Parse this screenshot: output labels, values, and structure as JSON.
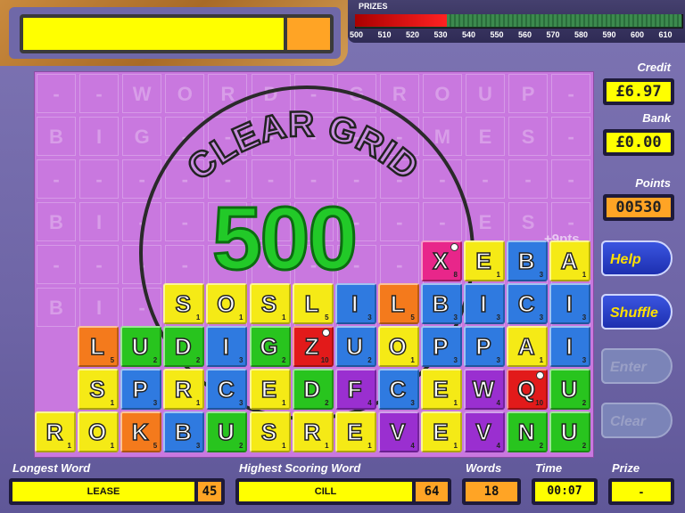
{
  "prizes": {
    "title": "PRIZES",
    "ticks": [
      "500",
      "510",
      "520",
      "530",
      "540",
      "550",
      "560",
      "570",
      "580",
      "590",
      "600",
      "610"
    ],
    "current_points": 530
  },
  "right_panel": {
    "credit_label": "Credit",
    "credit_value": "£6.97",
    "bank_label": "Bank",
    "bank_value": "£0.00",
    "points_label": "Points",
    "points_value": "00530",
    "help_label": "Help",
    "shuffle_label": "Shuffle",
    "enter_label": "Enter",
    "clear_label": "Clear"
  },
  "overlay": {
    "clear_grid_text": "CLEAR GRID",
    "bonus_value": "500",
    "pts_popup": "+9pts"
  },
  "background_letters": [
    [
      "-",
      "-",
      "W",
      "O",
      "R",
      "D",
      "-",
      "G",
      "R",
      "O",
      "U",
      "P",
      "-"
    ],
    [
      "B",
      "I",
      "G",
      "-",
      "-",
      "-",
      "-",
      "-",
      "-",
      "M",
      "E",
      "S",
      "-"
    ],
    [
      "-",
      "-",
      "-",
      "-",
      "-",
      "-",
      "-",
      "-",
      "-",
      "-",
      "-",
      "-",
      "-"
    ],
    [
      "B",
      "I",
      "-",
      "-",
      "-",
      "-",
      "-",
      "-",
      "-",
      "-",
      "E",
      "S",
      "-"
    ],
    [
      "-",
      "-",
      "-",
      "-",
      "-",
      "-",
      "-",
      "-",
      "-",
      "-",
      "-",
      "-",
      "-"
    ],
    [
      "B",
      "I",
      "-",
      "-",
      "-",
      "-",
      "-",
      "-",
      "-",
      "-",
      "-",
      "-",
      "-"
    ]
  ],
  "colors": {
    "yellow": "#f5ea16",
    "green": "#28c41e",
    "blue": "#2f7ae0",
    "orange": "#f47a1c",
    "purple": "#9a2fd0",
    "pink": "#e8268a",
    "red": "#e21a1a"
  },
  "tiles": [
    {
      "col": 9,
      "row": 4,
      "letter": "X",
      "score": "8",
      "color": "pink",
      "clock": true
    },
    {
      "col": 10,
      "row": 4,
      "letter": "E",
      "score": "1",
      "color": "yellow"
    },
    {
      "col": 11,
      "row": 4,
      "letter": "B",
      "score": "3",
      "color": "blue"
    },
    {
      "col": 12,
      "row": 4,
      "letter": "A",
      "score": "1",
      "color": "yellow"
    },
    {
      "col": 3,
      "row": 5,
      "letter": "S",
      "score": "1",
      "color": "yellow"
    },
    {
      "col": 4,
      "row": 5,
      "letter": "O",
      "score": "1",
      "color": "yellow"
    },
    {
      "col": 5,
      "row": 5,
      "letter": "S",
      "score": "1",
      "color": "yellow"
    },
    {
      "col": 6,
      "row": 5,
      "letter": "L",
      "score": "5",
      "color": "yellow"
    },
    {
      "col": 7,
      "row": 5,
      "letter": "I",
      "score": "3",
      "color": "blue"
    },
    {
      "col": 8,
      "row": 5,
      "letter": "L",
      "score": "5",
      "color": "orange"
    },
    {
      "col": 9,
      "row": 5,
      "letter": "B",
      "score": "3",
      "color": "blue"
    },
    {
      "col": 10,
      "row": 5,
      "letter": "I",
      "score": "3",
      "color": "blue"
    },
    {
      "col": 11,
      "row": 5,
      "letter": "C",
      "score": "3",
      "color": "blue"
    },
    {
      "col": 12,
      "row": 5,
      "letter": "I",
      "score": "3",
      "color": "blue"
    },
    {
      "col": 1,
      "row": 6,
      "letter": "L",
      "score": "5",
      "color": "orange"
    },
    {
      "col": 2,
      "row": 6,
      "letter": "U",
      "score": "2",
      "color": "green"
    },
    {
      "col": 3,
      "row": 6,
      "letter": "D",
      "score": "2",
      "color": "green"
    },
    {
      "col": 4,
      "row": 6,
      "letter": "I",
      "score": "3",
      "color": "blue"
    },
    {
      "col": 5,
      "row": 6,
      "letter": "G",
      "score": "2",
      "color": "green"
    },
    {
      "col": 6,
      "row": 6,
      "letter": "Z",
      "score": "10",
      "color": "red",
      "clock": true
    },
    {
      "col": 7,
      "row": 6,
      "letter": "U",
      "score": "2",
      "color": "blue"
    },
    {
      "col": 8,
      "row": 6,
      "letter": "O",
      "score": "1",
      "color": "yellow"
    },
    {
      "col": 9,
      "row": 6,
      "letter": "P",
      "score": "3",
      "color": "blue"
    },
    {
      "col": 10,
      "row": 6,
      "letter": "P",
      "score": "3",
      "color": "blue"
    },
    {
      "col": 11,
      "row": 6,
      "letter": "A",
      "score": "1",
      "color": "yellow"
    },
    {
      "col": 12,
      "row": 6,
      "letter": "I",
      "score": "3",
      "color": "blue"
    },
    {
      "col": 1,
      "row": 7,
      "letter": "S",
      "score": "1",
      "color": "yellow"
    },
    {
      "col": 2,
      "row": 7,
      "letter": "P",
      "score": "3",
      "color": "blue"
    },
    {
      "col": 3,
      "row": 7,
      "letter": "R",
      "score": "1",
      "color": "yellow"
    },
    {
      "col": 4,
      "row": 7,
      "letter": "C",
      "score": "3",
      "color": "blue"
    },
    {
      "col": 5,
      "row": 7,
      "letter": "E",
      "score": "1",
      "color": "yellow"
    },
    {
      "col": 6,
      "row": 7,
      "letter": "D",
      "score": "2",
      "color": "green"
    },
    {
      "col": 7,
      "row": 7,
      "letter": "F",
      "score": "4",
      "color": "purple"
    },
    {
      "col": 8,
      "row": 7,
      "letter": "C",
      "score": "3",
      "color": "blue"
    },
    {
      "col": 9,
      "row": 7,
      "letter": "E",
      "score": "1",
      "color": "yellow"
    },
    {
      "col": 10,
      "row": 7,
      "letter": "W",
      "score": "4",
      "color": "purple"
    },
    {
      "col": 11,
      "row": 7,
      "letter": "Q",
      "score": "10",
      "color": "red",
      "clock": true
    },
    {
      "col": 12,
      "row": 7,
      "letter": "U",
      "score": "2",
      "color": "green"
    },
    {
      "col": 0,
      "row": 8,
      "letter": "R",
      "score": "1",
      "color": "yellow"
    },
    {
      "col": 1,
      "row": 8,
      "letter": "O",
      "score": "1",
      "color": "yellow"
    },
    {
      "col": 2,
      "row": 8,
      "letter": "K",
      "score": "5",
      "color": "orange"
    },
    {
      "col": 3,
      "row": 8,
      "letter": "B",
      "score": "3",
      "color": "blue"
    },
    {
      "col": 4,
      "row": 8,
      "letter": "U",
      "score": "2",
      "color": "green"
    },
    {
      "col": 5,
      "row": 8,
      "letter": "S",
      "score": "1",
      "color": "yellow"
    },
    {
      "col": 6,
      "row": 8,
      "letter": "R",
      "score": "1",
      "color": "yellow"
    },
    {
      "col": 7,
      "row": 8,
      "letter": "E",
      "score": "1",
      "color": "yellow"
    },
    {
      "col": 8,
      "row": 8,
      "letter": "V",
      "score": "4",
      "color": "purple"
    },
    {
      "col": 9,
      "row": 8,
      "letter": "E",
      "score": "1",
      "color": "yellow"
    },
    {
      "col": 10,
      "row": 8,
      "letter": "V",
      "score": "4",
      "color": "purple"
    },
    {
      "col": 11,
      "row": 8,
      "letter": "N",
      "score": "2",
      "color": "green"
    },
    {
      "col": 12,
      "row": 8,
      "letter": "U",
      "score": "2",
      "color": "green"
    }
  ],
  "bottom": {
    "longest_label": "Longest Word",
    "longest_word": "LEASE",
    "longest_score": "45",
    "highest_label": "Highest Scoring Word",
    "highest_word": "CILL",
    "highest_score": "64",
    "words_label": "Words",
    "words_value": "18",
    "time_label": "Time",
    "time_value": "00:07",
    "prize_label": "Prize",
    "prize_value": "-"
  }
}
